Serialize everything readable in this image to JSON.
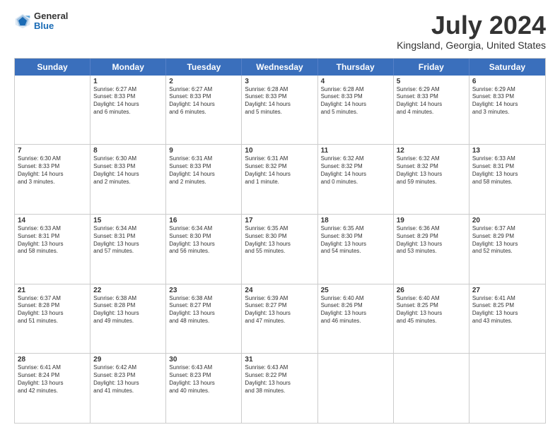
{
  "logo": {
    "line1": "General",
    "line2": "Blue"
  },
  "title": "July 2024",
  "subtitle": "Kingsland, Georgia, United States",
  "days": [
    "Sunday",
    "Monday",
    "Tuesday",
    "Wednesday",
    "Thursday",
    "Friday",
    "Saturday"
  ],
  "weeks": [
    [
      {
        "date": "",
        "info": ""
      },
      {
        "date": "1",
        "info": "Sunrise: 6:27 AM\nSunset: 8:33 PM\nDaylight: 14 hours\nand 6 minutes."
      },
      {
        "date": "2",
        "info": "Sunrise: 6:27 AM\nSunset: 8:33 PM\nDaylight: 14 hours\nand 6 minutes."
      },
      {
        "date": "3",
        "info": "Sunrise: 6:28 AM\nSunset: 8:33 PM\nDaylight: 14 hours\nand 5 minutes."
      },
      {
        "date": "4",
        "info": "Sunrise: 6:28 AM\nSunset: 8:33 PM\nDaylight: 14 hours\nand 5 minutes."
      },
      {
        "date": "5",
        "info": "Sunrise: 6:29 AM\nSunset: 8:33 PM\nDaylight: 14 hours\nand 4 minutes."
      },
      {
        "date": "6",
        "info": "Sunrise: 6:29 AM\nSunset: 8:33 PM\nDaylight: 14 hours\nand 3 minutes."
      }
    ],
    [
      {
        "date": "7",
        "info": "Sunrise: 6:30 AM\nSunset: 8:33 PM\nDaylight: 14 hours\nand 3 minutes."
      },
      {
        "date": "8",
        "info": "Sunrise: 6:30 AM\nSunset: 8:33 PM\nDaylight: 14 hours\nand 2 minutes."
      },
      {
        "date": "9",
        "info": "Sunrise: 6:31 AM\nSunset: 8:33 PM\nDaylight: 14 hours\nand 2 minutes."
      },
      {
        "date": "10",
        "info": "Sunrise: 6:31 AM\nSunset: 8:32 PM\nDaylight: 14 hours\nand 1 minute."
      },
      {
        "date": "11",
        "info": "Sunrise: 6:32 AM\nSunset: 8:32 PM\nDaylight: 14 hours\nand 0 minutes."
      },
      {
        "date": "12",
        "info": "Sunrise: 6:32 AM\nSunset: 8:32 PM\nDaylight: 13 hours\nand 59 minutes."
      },
      {
        "date": "13",
        "info": "Sunrise: 6:33 AM\nSunset: 8:31 PM\nDaylight: 13 hours\nand 58 minutes."
      }
    ],
    [
      {
        "date": "14",
        "info": "Sunrise: 6:33 AM\nSunset: 8:31 PM\nDaylight: 13 hours\nand 58 minutes."
      },
      {
        "date": "15",
        "info": "Sunrise: 6:34 AM\nSunset: 8:31 PM\nDaylight: 13 hours\nand 57 minutes."
      },
      {
        "date": "16",
        "info": "Sunrise: 6:34 AM\nSunset: 8:30 PM\nDaylight: 13 hours\nand 56 minutes."
      },
      {
        "date": "17",
        "info": "Sunrise: 6:35 AM\nSunset: 8:30 PM\nDaylight: 13 hours\nand 55 minutes."
      },
      {
        "date": "18",
        "info": "Sunrise: 6:35 AM\nSunset: 8:30 PM\nDaylight: 13 hours\nand 54 minutes."
      },
      {
        "date": "19",
        "info": "Sunrise: 6:36 AM\nSunset: 8:29 PM\nDaylight: 13 hours\nand 53 minutes."
      },
      {
        "date": "20",
        "info": "Sunrise: 6:37 AM\nSunset: 8:29 PM\nDaylight: 13 hours\nand 52 minutes."
      }
    ],
    [
      {
        "date": "21",
        "info": "Sunrise: 6:37 AM\nSunset: 8:28 PM\nDaylight: 13 hours\nand 51 minutes."
      },
      {
        "date": "22",
        "info": "Sunrise: 6:38 AM\nSunset: 8:28 PM\nDaylight: 13 hours\nand 49 minutes."
      },
      {
        "date": "23",
        "info": "Sunrise: 6:38 AM\nSunset: 8:27 PM\nDaylight: 13 hours\nand 48 minutes."
      },
      {
        "date": "24",
        "info": "Sunrise: 6:39 AM\nSunset: 8:27 PM\nDaylight: 13 hours\nand 47 minutes."
      },
      {
        "date": "25",
        "info": "Sunrise: 6:40 AM\nSunset: 8:26 PM\nDaylight: 13 hours\nand 46 minutes."
      },
      {
        "date": "26",
        "info": "Sunrise: 6:40 AM\nSunset: 8:25 PM\nDaylight: 13 hours\nand 45 minutes."
      },
      {
        "date": "27",
        "info": "Sunrise: 6:41 AM\nSunset: 8:25 PM\nDaylight: 13 hours\nand 43 minutes."
      }
    ],
    [
      {
        "date": "28",
        "info": "Sunrise: 6:41 AM\nSunset: 8:24 PM\nDaylight: 13 hours\nand 42 minutes."
      },
      {
        "date": "29",
        "info": "Sunrise: 6:42 AM\nSunset: 8:23 PM\nDaylight: 13 hours\nand 41 minutes."
      },
      {
        "date": "30",
        "info": "Sunrise: 6:43 AM\nSunset: 8:23 PM\nDaylight: 13 hours\nand 40 minutes."
      },
      {
        "date": "31",
        "info": "Sunrise: 6:43 AM\nSunset: 8:22 PM\nDaylight: 13 hours\nand 38 minutes."
      },
      {
        "date": "",
        "info": ""
      },
      {
        "date": "",
        "info": ""
      },
      {
        "date": "",
        "info": ""
      }
    ]
  ]
}
